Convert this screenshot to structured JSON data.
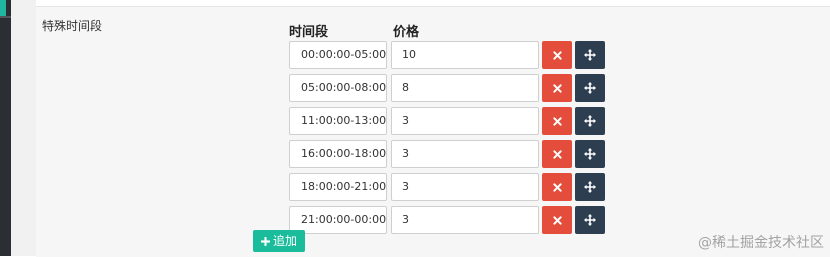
{
  "section_label": "特殊时间段",
  "columns": {
    "time": "时间段",
    "price": "价格"
  },
  "rows": [
    {
      "time": "00:00:00-05:00:",
      "price": "10"
    },
    {
      "time": "05:00:00-08:00:",
      "price": "8"
    },
    {
      "time": "11:00:00-13:00:",
      "price": "3"
    },
    {
      "time": "16:00:00-18:00:",
      "price": "3"
    },
    {
      "time": "18:00:00-21:00:",
      "price": "3"
    },
    {
      "time": "21:00:00-00:00:",
      "price": "3"
    }
  ],
  "icons": {
    "delete": "close-icon",
    "move": "move-arrows-icon",
    "add": "plus-icon"
  },
  "add_button_label": "追加",
  "watermark": "@稀土掘金技术社区",
  "colors": {
    "delete": "#e44d3b",
    "move": "#2c3e50",
    "add": "#1abc9c",
    "sidebar": "#2b2f33",
    "sidebar_accent": "#1fb7a0"
  }
}
